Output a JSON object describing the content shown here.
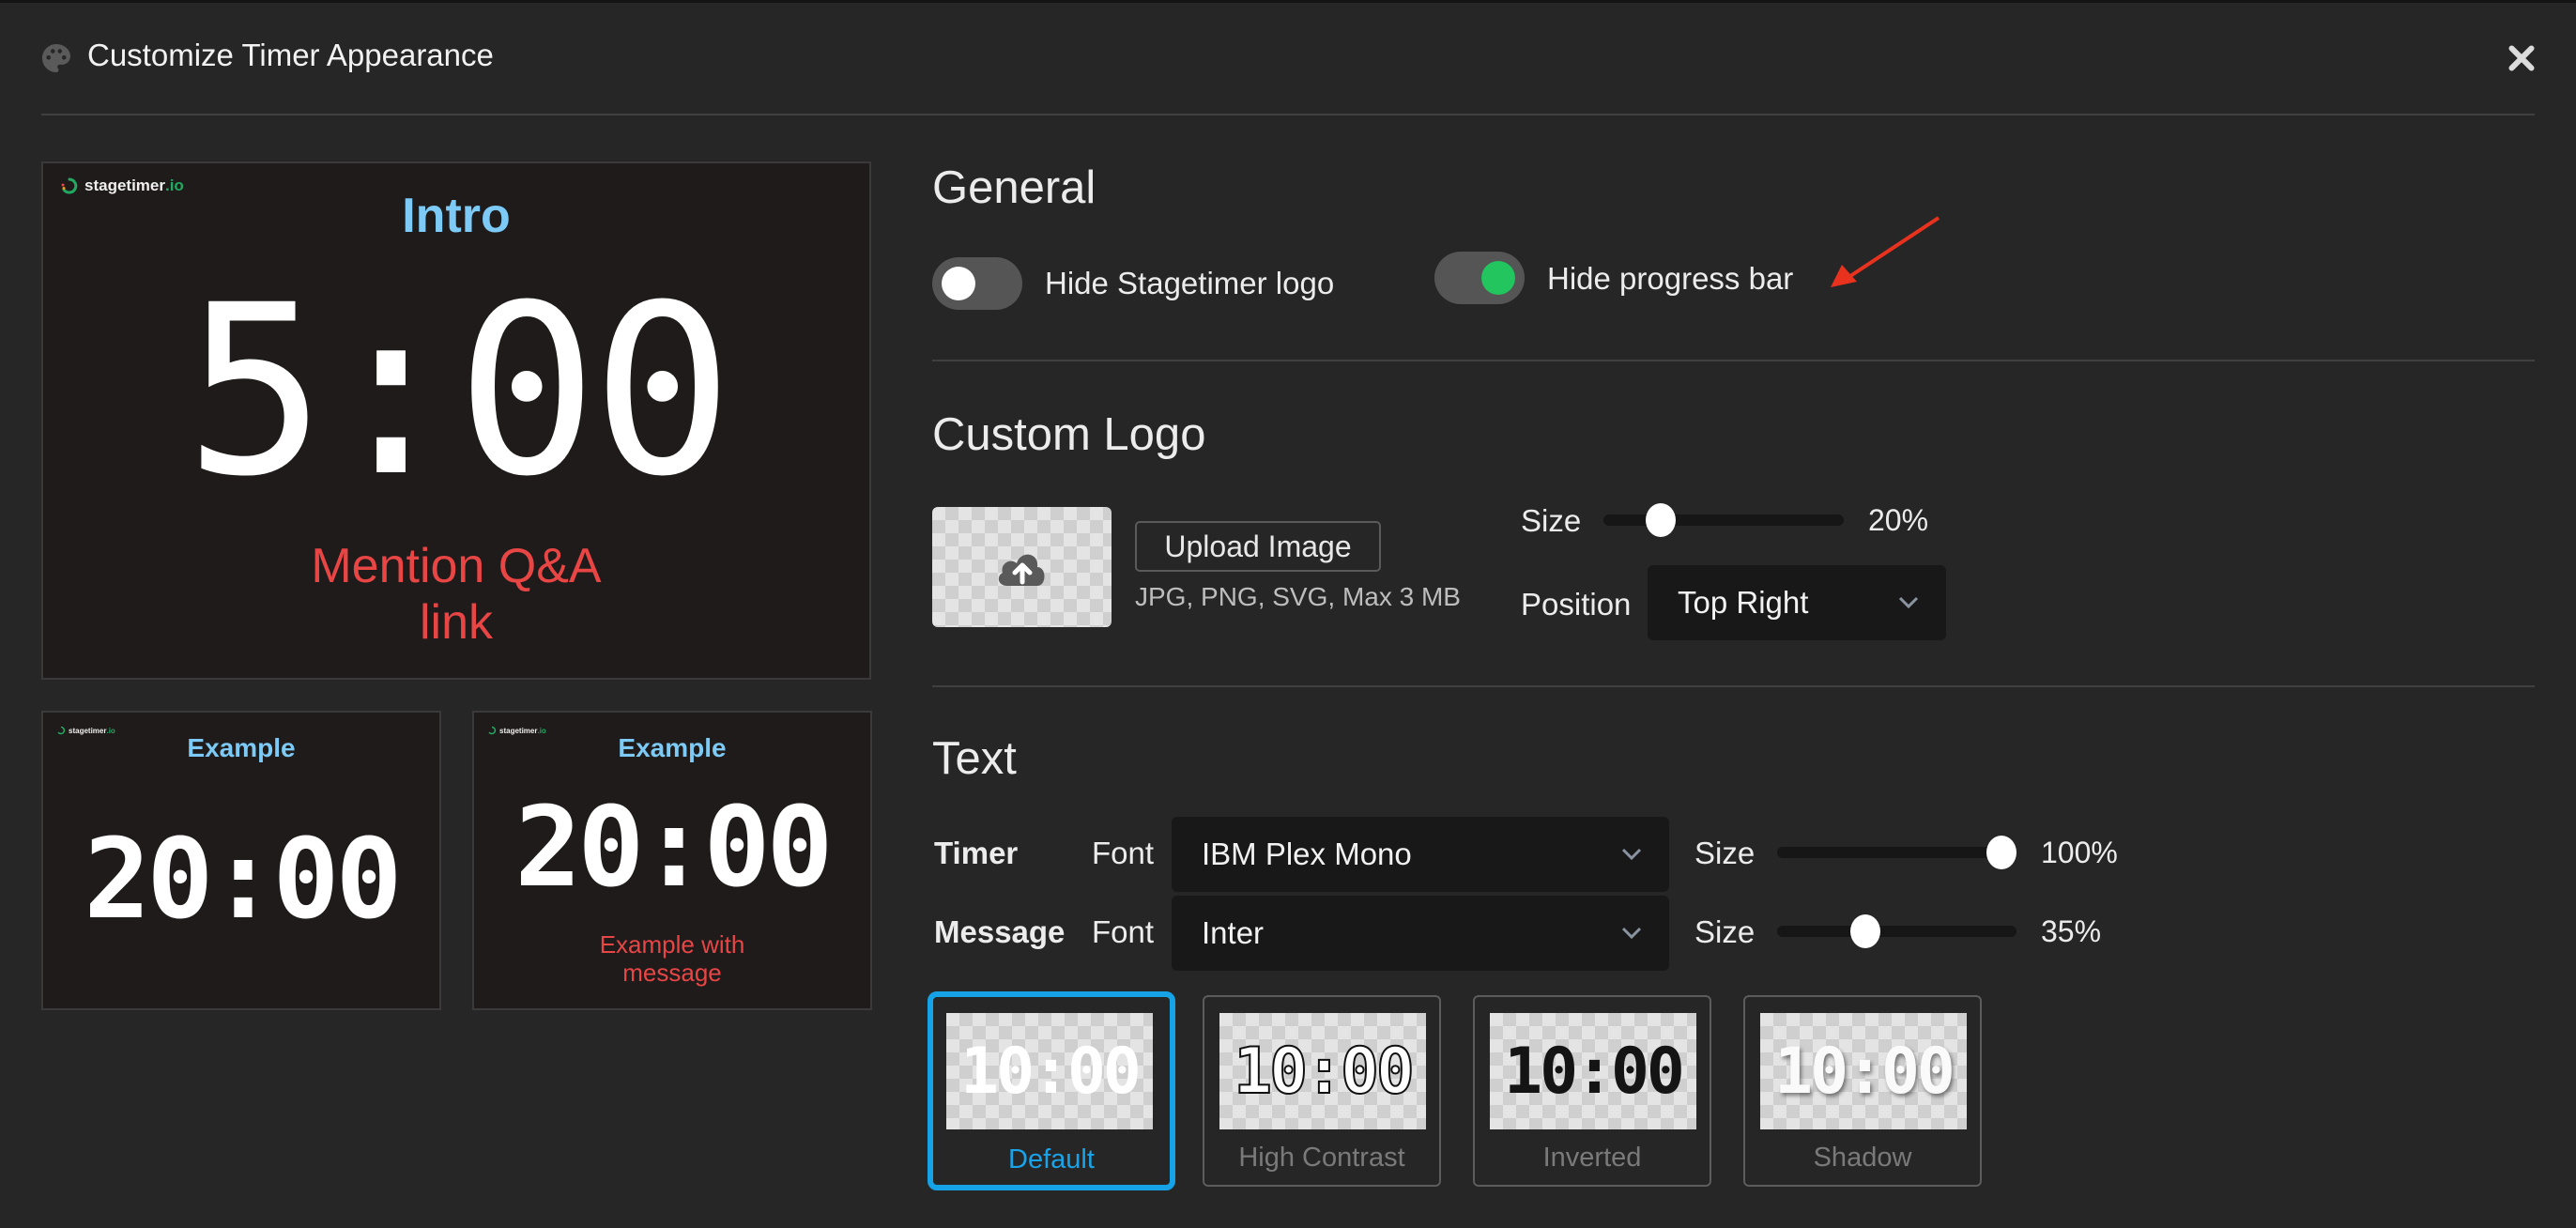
{
  "dialog": {
    "title": "Customize Timer Appearance",
    "title_icon": "palette-icon",
    "close_icon": "close-icon"
  },
  "previews": {
    "main": {
      "brand": "stagetimer",
      "brand_suffix": ".io",
      "title": "Intro",
      "timer": "5:00",
      "message_line1": "Mention Q&A",
      "message_line2": "link"
    },
    "example1": {
      "brand": "stagetimer",
      "brand_suffix": ".io",
      "title": "Example",
      "timer": "20:00"
    },
    "example2": {
      "brand": "stagetimer",
      "brand_suffix": ".io",
      "title": "Example",
      "timer": "20:00",
      "message_line1": "Example with",
      "message_line2": "message"
    }
  },
  "general": {
    "heading": "General",
    "hide_logo": {
      "label": "Hide Stagetimer logo",
      "checked": false
    },
    "hide_progress": {
      "label": "Hide progress bar",
      "checked": true
    },
    "annotation": "red-arrow-pointing-to-hide-progress-bar"
  },
  "custom_logo": {
    "heading": "Custom Logo",
    "upload_icon": "cloud-upload-icon",
    "upload_button": "Upload Image",
    "hint": "JPG, PNG, SVG, Max 3 MB",
    "size_label": "Size",
    "size_value": "20%",
    "size_fraction": 0.2,
    "position_label": "Position",
    "position_value": "Top Right"
  },
  "text": {
    "heading": "Text",
    "timer": {
      "label": "Timer",
      "font_label": "Font",
      "font_value": "IBM Plex Mono",
      "size_label": "Size",
      "size_value": "100%",
      "size_fraction": 1.0
    },
    "message": {
      "label": "Message",
      "font_label": "Font",
      "font_value": "Inter",
      "size_label": "Size",
      "size_value": "35%",
      "size_fraction": 0.35
    },
    "presets": [
      {
        "label": "Default",
        "sample": "10:00",
        "selected": true
      },
      {
        "label": "High Contrast",
        "sample": "10:00",
        "selected": false
      },
      {
        "label": "Inverted",
        "sample": "10:00",
        "selected": false
      },
      {
        "label": "Shadow",
        "sample": "10:00",
        "selected": false
      }
    ]
  },
  "colors": {
    "background": "#262626",
    "preview_bg": "#1e1b1a",
    "title_blue": "#7ccaf5",
    "message_red": "#e84545",
    "toggle_on": "#22c55e",
    "accent": "#16a2e6",
    "brand_green": "#22a861"
  }
}
